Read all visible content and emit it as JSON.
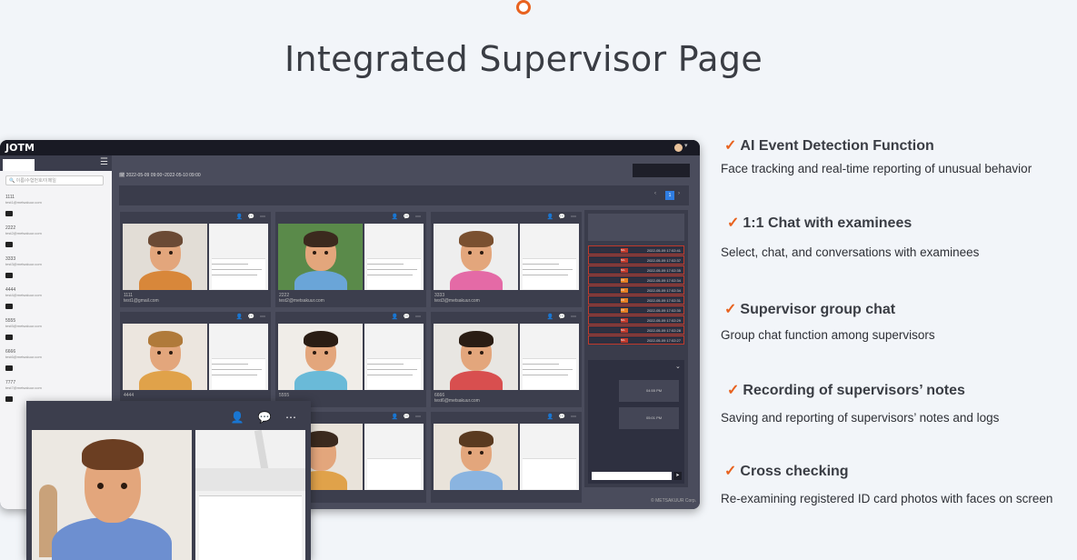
{
  "page": {
    "title": "Integrated Supervisor Page"
  },
  "app": {
    "logo": "JOTM",
    "date_range": "2022-05-09 09:00~2022-05-10 09:00",
    "search_placeholder": "이름/수험번호/이메일",
    "page_number": "1",
    "copyright": "© METSAKUUR Corp.",
    "sidebar_items": [
      {
        "name": "1111",
        "email": "test1@metsakuur.com"
      },
      {
        "name": "2222",
        "email": "test2@metsakuur.com"
      },
      {
        "name": "3333",
        "email": "test3@metsakuur.com"
      },
      {
        "name": "4444",
        "email": "test4@metsakuur.com"
      },
      {
        "name": "5555",
        "email": "test5@metsakuur.com"
      },
      {
        "name": "6666",
        "email": "test6@metsakuur.com"
      },
      {
        "name": "7777",
        "email": "test7@metsakuur.com"
      }
    ],
    "cards": [
      {
        "label": "1111",
        "email": "test1@gmail.com"
      },
      {
        "label": "2222",
        "email": "test2@metsakuur.com"
      },
      {
        "label": "3333",
        "email": "test3@metsakuur.com"
      },
      {
        "label": "4444",
        "email": ""
      },
      {
        "label": "5555",
        "email": ""
      },
      {
        "label": "6666",
        "email": "test6@metsakuur.com"
      }
    ],
    "event_log": [
      {
        "tag": "NG",
        "time": "2022-05-09 17:02:41"
      },
      {
        "tag": "NG",
        "time": "2022-05-09 17:02:37"
      },
      {
        "tag": "NG",
        "time": "2022-05-09 17:02:35"
      },
      {
        "tag": "CK",
        "time": "2022-05-09 17:02:34"
      },
      {
        "tag": "CK",
        "time": "2022-05-09 17:02:34"
      },
      {
        "tag": "CK",
        "time": "2022-05-09 17:02:31"
      },
      {
        "tag": "CK",
        "time": "2022-05-09 17:02:30"
      },
      {
        "tag": "NG",
        "time": "2022-05-09 17:02:29"
      },
      {
        "tag": "NG",
        "time": "2022-05-09 17:02:28"
      },
      {
        "tag": "NG",
        "time": "2022-05-09 17:02:27"
      }
    ],
    "chat_times": [
      "04:55 PM",
      "05:01 PM"
    ]
  },
  "features": [
    {
      "title": "AI Event Detection Function",
      "desc": "Face tracking and real-time reporting of unusual behavior"
    },
    {
      "title": "1:1 Chat with examinees",
      "desc": "Select, chat, and conversations with examinees"
    },
    {
      "title": "Supervisor group chat",
      "desc": "Group chat function among supervisors"
    },
    {
      "title": "Recording of supervisors’ notes",
      "desc": "Saving and reporting of supervisors’ notes and logs"
    },
    {
      "title": "Cross checking",
      "desc": "Re-examining registered ID card photos with faces on screen"
    }
  ],
  "colors": {
    "accent": "#e8621f",
    "app_bg": "#2e3040",
    "badge_ng": "#c0392b",
    "badge_ck": "#e67e22"
  }
}
